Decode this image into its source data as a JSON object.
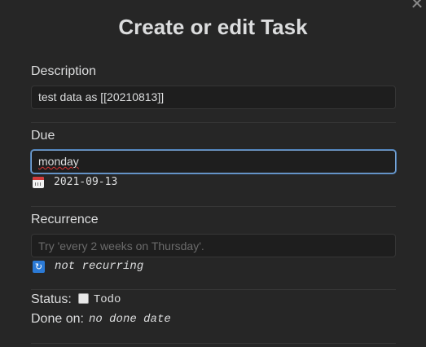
{
  "dialog": {
    "title": "Create or edit Task",
    "close_glyph": "✕"
  },
  "description": {
    "label": "Description",
    "value": "test data as [[20210813]]"
  },
  "due": {
    "label": "Due",
    "value": "monday",
    "parsed_date": "2021-09-13",
    "icon": "calendar-icon"
  },
  "recurrence": {
    "label": "Recurrence",
    "value": "",
    "placeholder": "Try 'every 2 weeks on Thursday'.",
    "parsed": "not recurring",
    "icon": "repeat-icon"
  },
  "status": {
    "label": "Status:",
    "checkbox_checked": false,
    "value": "Todo"
  },
  "done_on": {
    "label": "Done on:",
    "value": "no done date"
  },
  "colors": {
    "background": "#262626",
    "input_background": "#1e1e1e",
    "focus_border": "#7aa7d9",
    "recurring_icon": "#2b7ad6"
  }
}
